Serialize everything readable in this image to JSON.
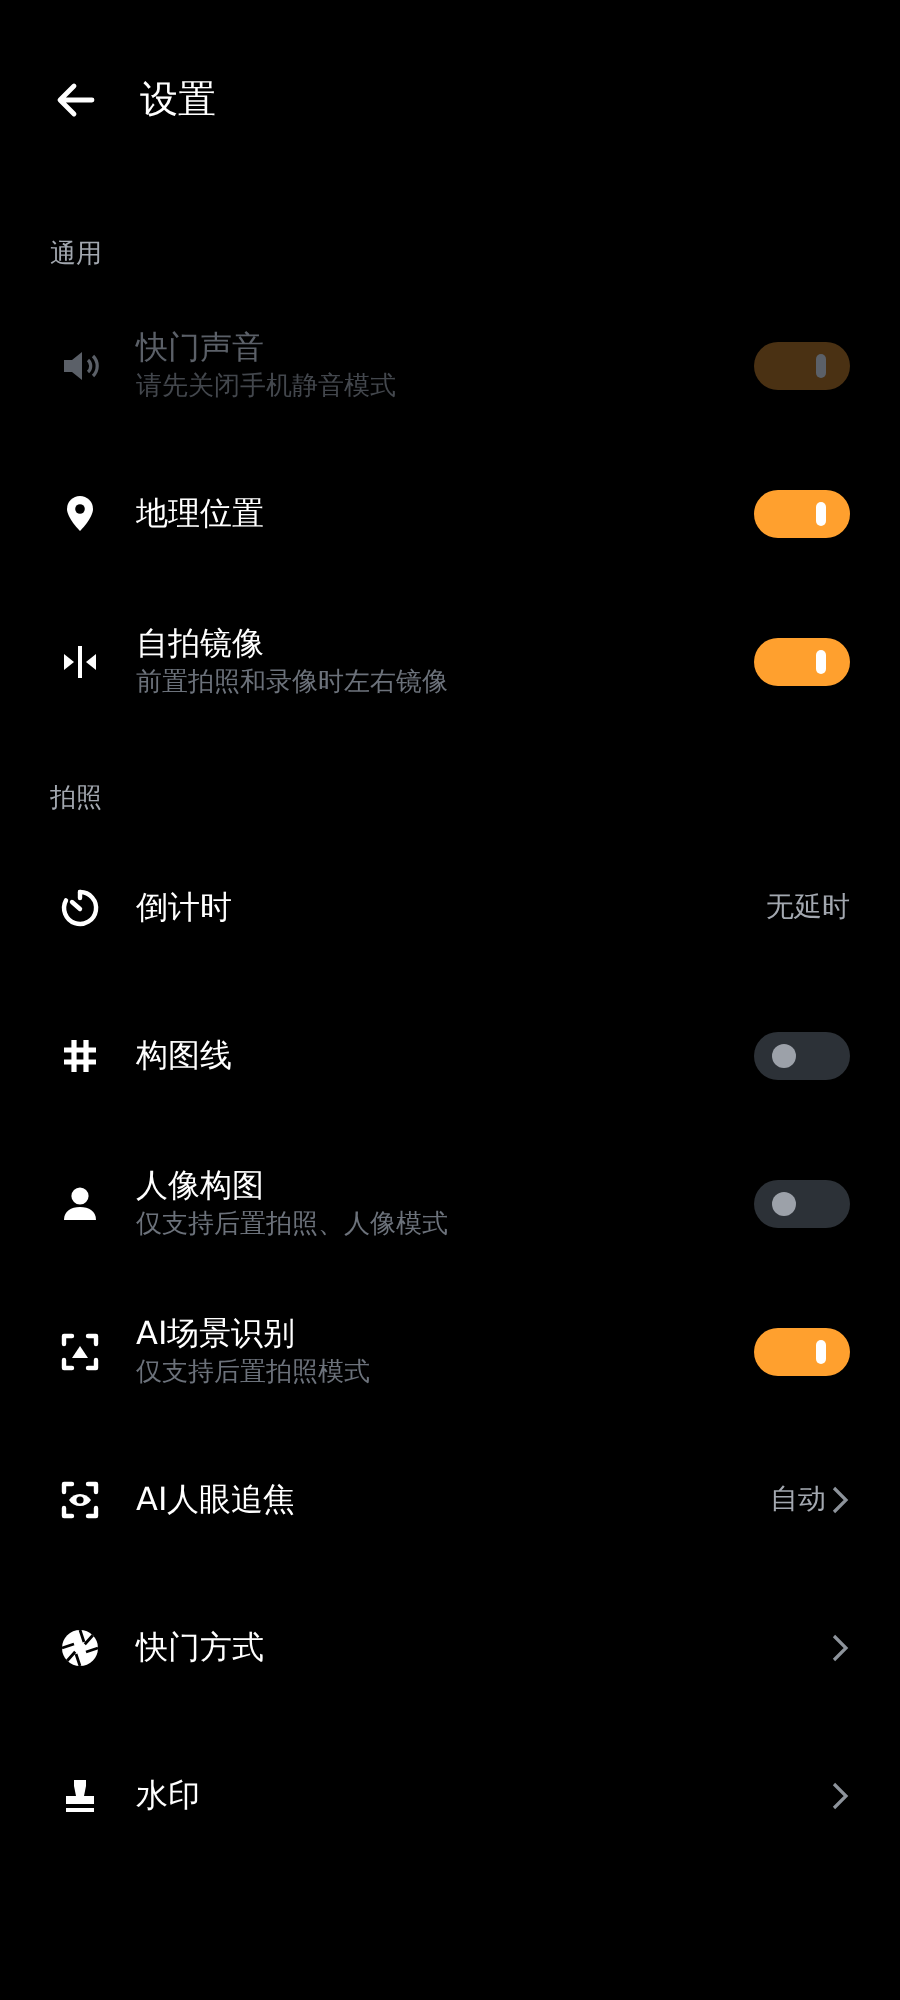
{
  "header": {
    "title": "设置"
  },
  "sections": [
    {
      "title": "通用",
      "items": [
        {
          "kind": "toggle",
          "title": "快门声音",
          "subtitle": "请先关闭手机静音模式",
          "on": true,
          "disabled": true
        },
        {
          "kind": "toggle",
          "title": "地理位置",
          "on": true,
          "disabled": false
        },
        {
          "kind": "toggle",
          "title": "自拍镜像",
          "subtitle": "前置拍照和录像时左右镜像",
          "on": true,
          "disabled": false
        }
      ]
    },
    {
      "title": "拍照",
      "items": [
        {
          "kind": "value",
          "title": "倒计时",
          "value": "无延时",
          "disabled": false
        },
        {
          "kind": "toggle",
          "title": "构图线",
          "on": false,
          "disabled": false
        },
        {
          "kind": "toggle",
          "title": "人像构图",
          "subtitle": "仅支持后置拍照、人像模式",
          "on": false,
          "disabled": false
        },
        {
          "kind": "toggle",
          "title": "AI场景识别",
          "subtitle": "仅支持后置拍照模式",
          "on": true,
          "disabled": false
        },
        {
          "kind": "link",
          "title": "AI人眼追焦",
          "value": "自动",
          "disabled": false
        },
        {
          "kind": "link",
          "title": "快门方式",
          "disabled": false
        },
        {
          "kind": "link",
          "title": "水印",
          "disabled": false
        }
      ]
    }
  ]
}
